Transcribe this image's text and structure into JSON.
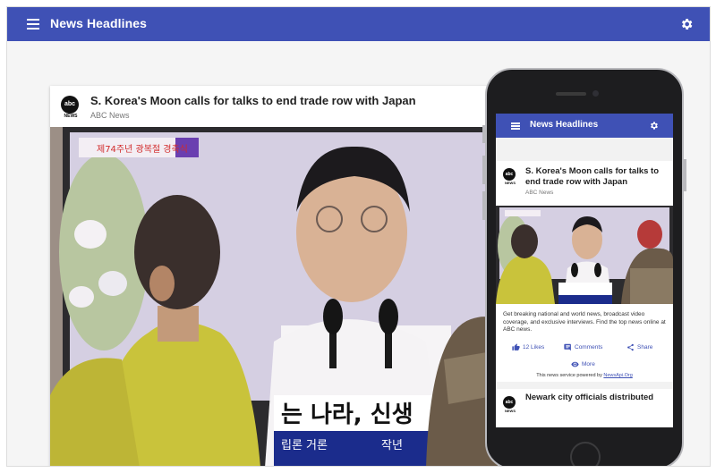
{
  "app": {
    "title": "News Headlines",
    "accent_color": "#3f51b5",
    "menu_icon": "menu-icon",
    "settings_icon": "gear-icon"
  },
  "main_card": {
    "title": "S. Korea's Moon calls for talks to end trade row with Japan",
    "source": "ABC News",
    "logo_text": "abc",
    "logo_label": "NEWS",
    "image_text": {
      "banner": "제74주년 광복절 경축식",
      "caption_line1": "는 나라, 신생",
      "caption_line2": "립론 거론",
      "caption_line3": "작년"
    }
  },
  "phone": {
    "app_title": "News Headlines",
    "article": {
      "title": "S. Korea's Moon calls for talks to end trade row with Japan",
      "source": "ABC News",
      "logo_text": "abc",
      "logo_label": "NEWS",
      "description": "Get breaking national and world news, broadcast video coverage, and exclusive interviews. Find the top news online at ABC news.",
      "likes": "12 Likes",
      "comments": "Comments",
      "share": "Share",
      "more": "More",
      "footer_text": "This news service powered by",
      "footer_link": "NewsApi.Org"
    },
    "next_article": {
      "title": "Newark city officials distributed",
      "logo_text": "abc",
      "logo_label": "NEWS"
    }
  }
}
